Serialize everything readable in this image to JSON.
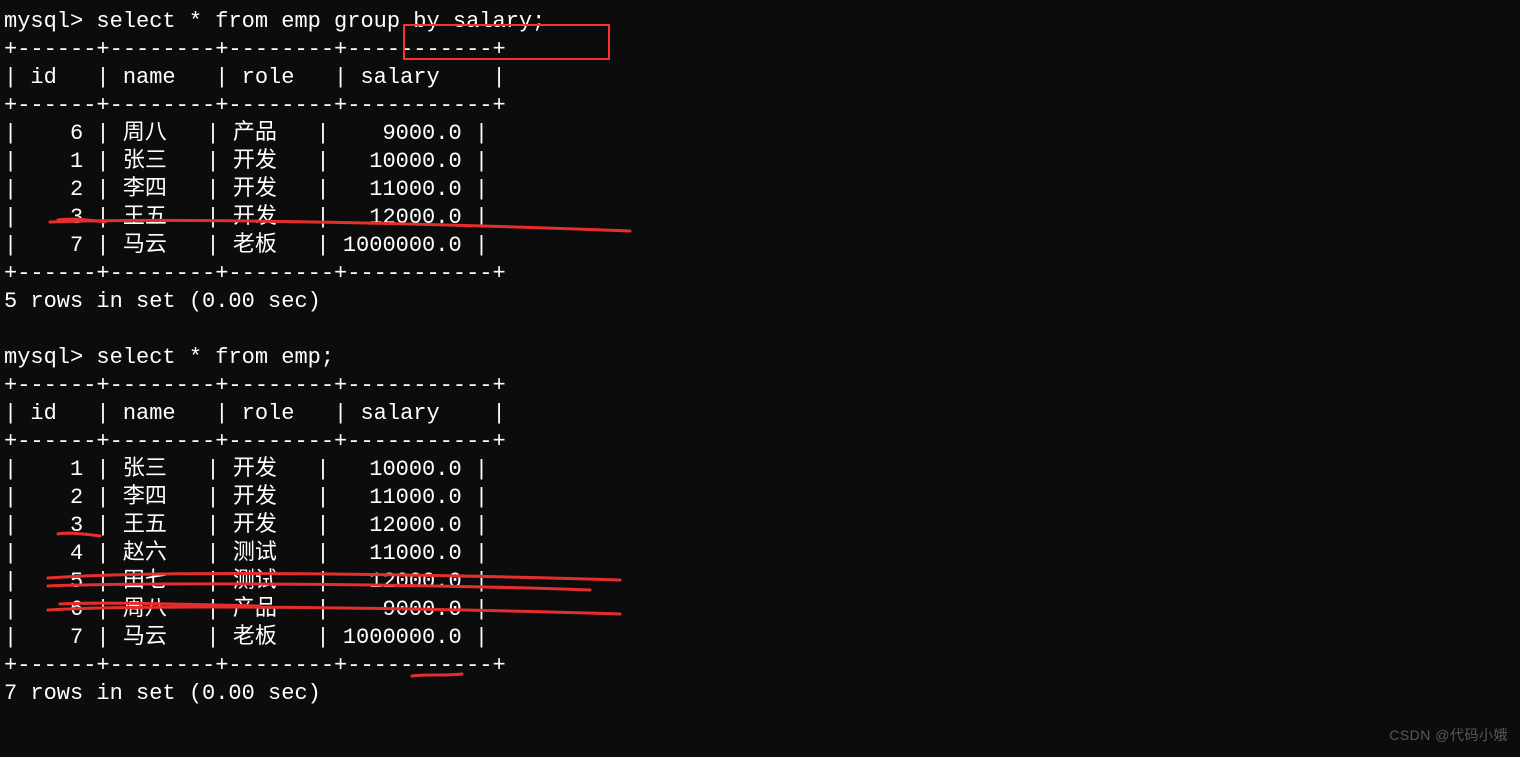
{
  "terminal": {
    "prompt": "mysql>",
    "query1": "select * from emp group by salary;",
    "query2": "select * from emp;",
    "columns": [
      "id",
      "name",
      "role",
      "salary"
    ],
    "table_border": "+------+--------+--------+-----------+",
    "result1_rows": [
      {
        "id": "6",
        "name": "周八",
        "role": "产品",
        "salary": "9000.0"
      },
      {
        "id": "1",
        "name": "张三",
        "role": "开发",
        "salary": "10000.0"
      },
      {
        "id": "2",
        "name": "李四",
        "role": "开发",
        "salary": "11000.0"
      },
      {
        "id": "3",
        "name": "王五",
        "role": "开发",
        "salary": "12000.0"
      },
      {
        "id": "7",
        "name": "马云",
        "role": "老板",
        "salary": "1000000.0"
      }
    ],
    "result1_footer": "5 rows in set (0.00 sec)",
    "result2_rows": [
      {
        "id": "1",
        "name": "张三",
        "role": "开发",
        "salary": "10000.0"
      },
      {
        "id": "2",
        "name": "李四",
        "role": "开发",
        "salary": "11000.0"
      },
      {
        "id": "3",
        "name": "王五",
        "role": "开发",
        "salary": "12000.0"
      },
      {
        "id": "4",
        "name": "赵六",
        "role": "测试",
        "salary": "11000.0"
      },
      {
        "id": "5",
        "name": "田七",
        "role": "测试",
        "salary": "12000.0"
      },
      {
        "id": "6",
        "name": "周八",
        "role": "产品",
        "salary": "9000.0"
      },
      {
        "id": "7",
        "name": "马云",
        "role": "老板",
        "salary": "1000000.0"
      }
    ],
    "result2_footer": "7 rows in set (0.00 sec)"
  },
  "watermark": "CSDN @代码小娥"
}
